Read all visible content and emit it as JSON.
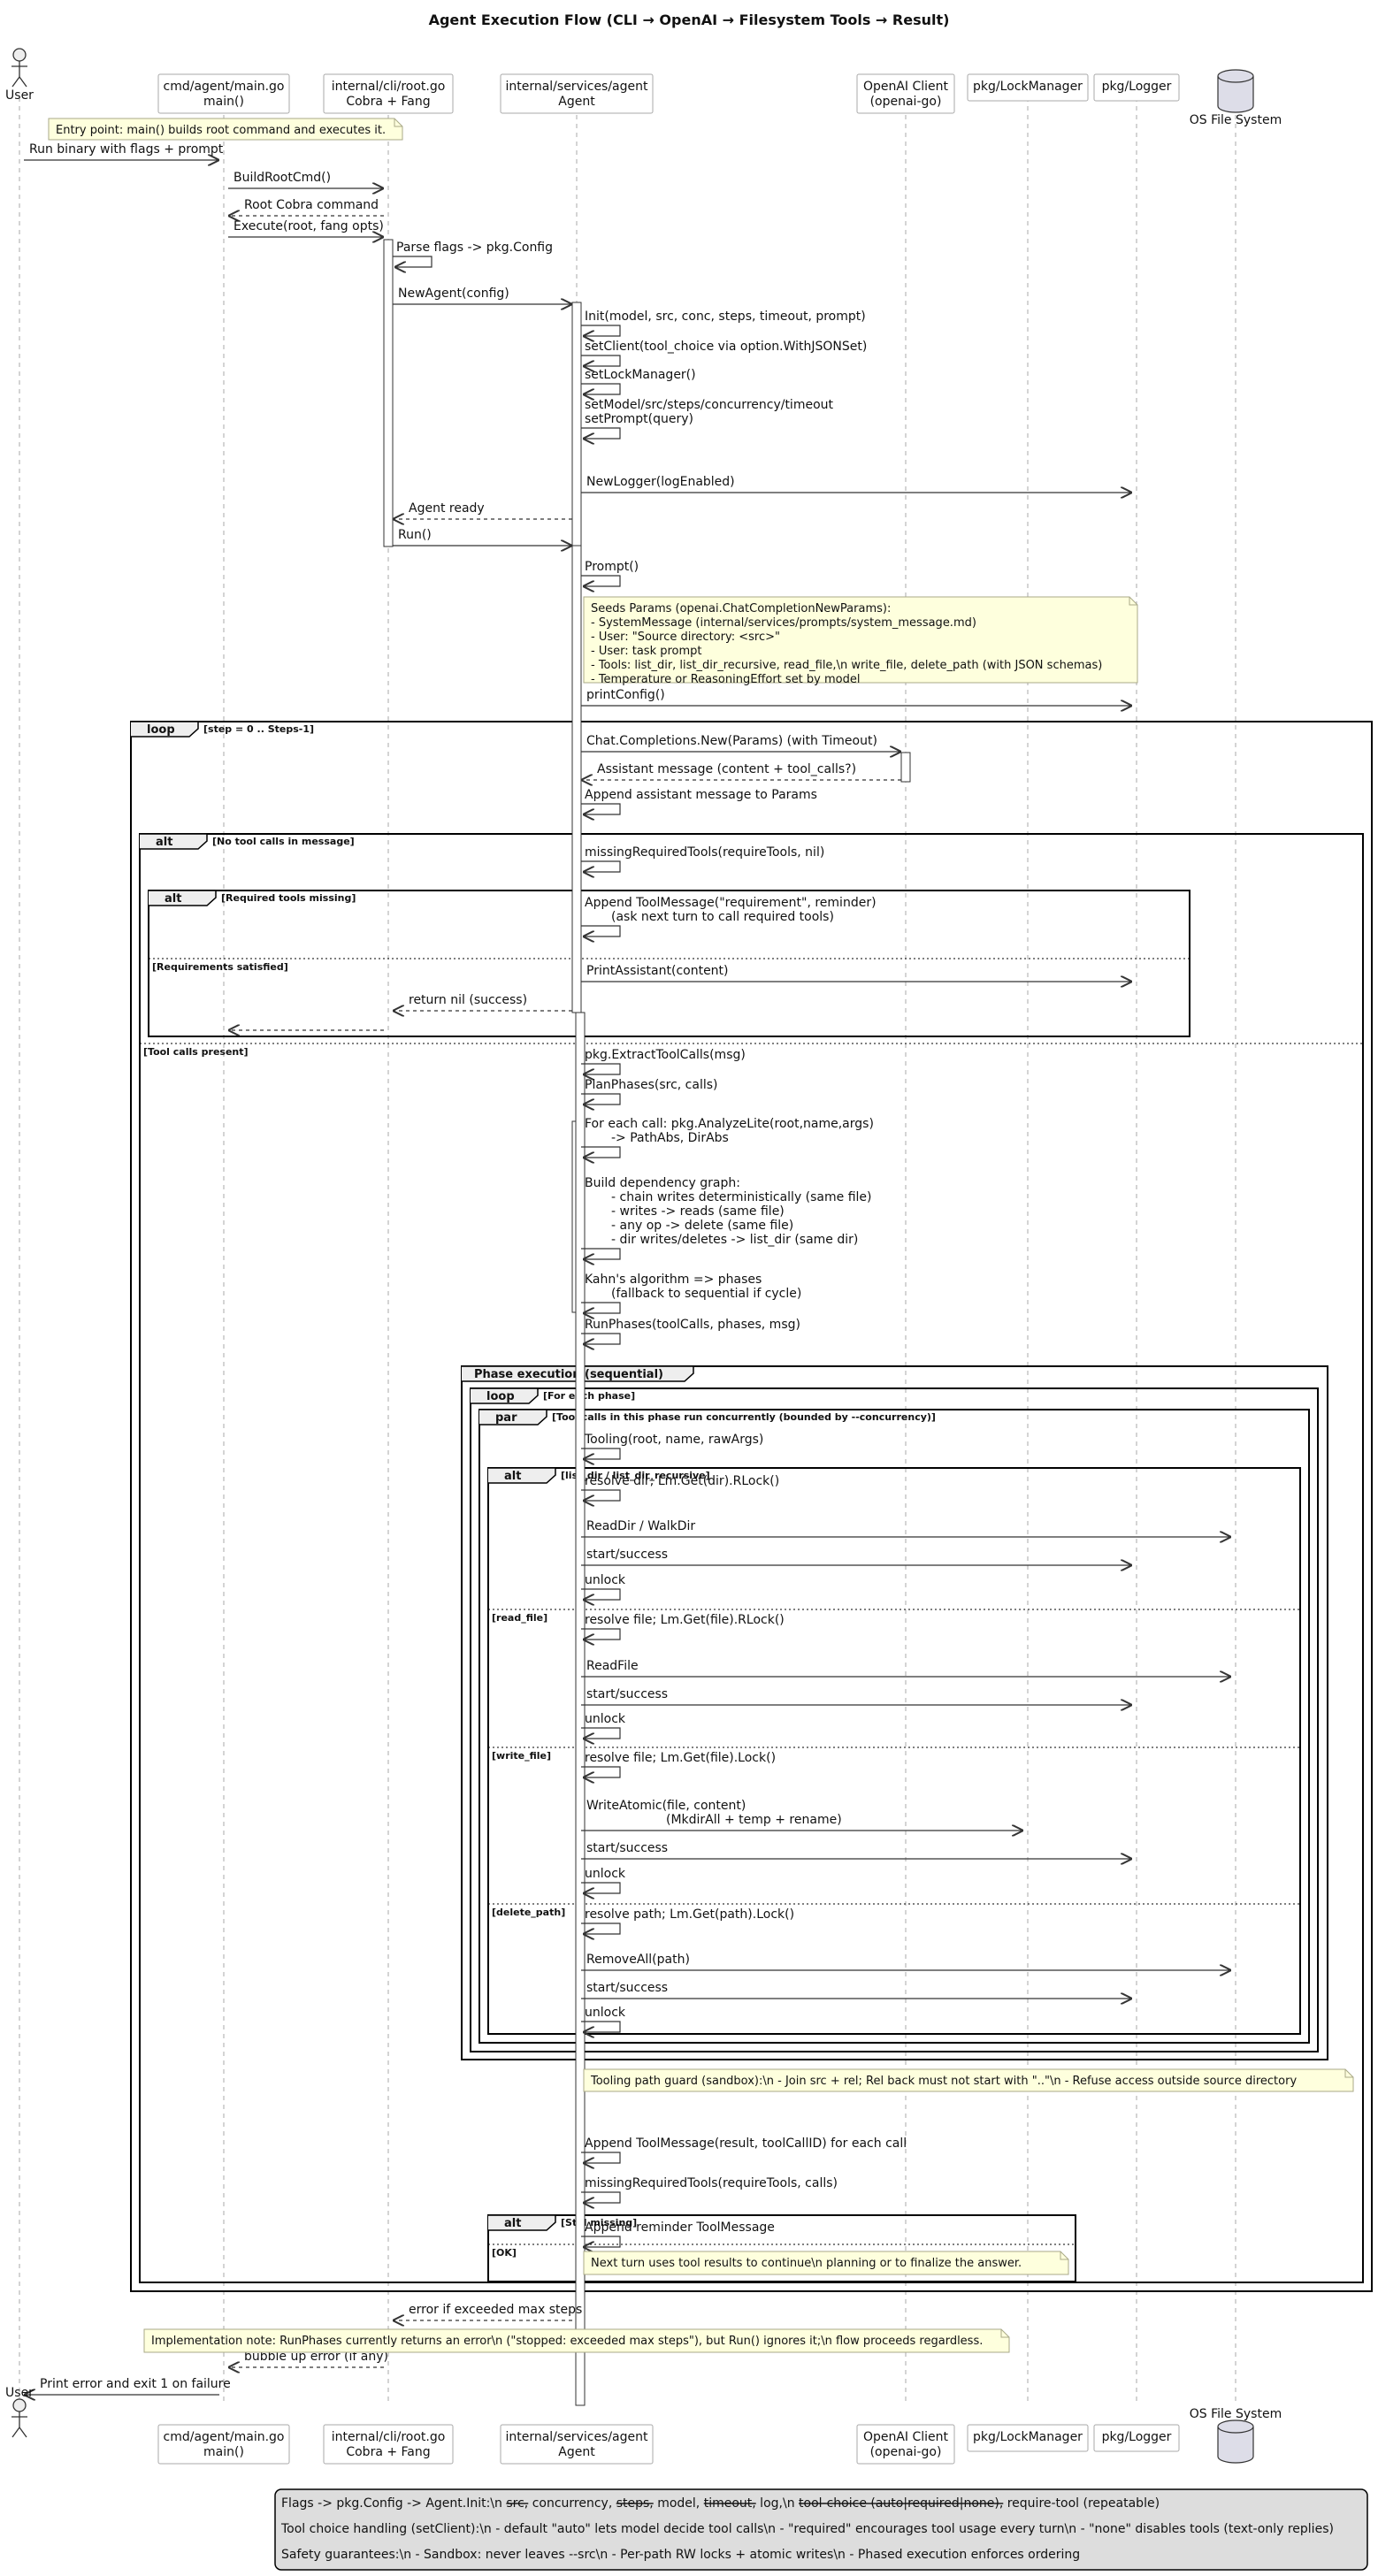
{
  "title": "Agent Execution Flow (CLI → OpenAI → Filesystem Tools → Result)",
  "participants": [
    {
      "id": "user",
      "kind": "actor",
      "lines": [
        "User"
      ]
    },
    {
      "id": "main",
      "kind": "box",
      "lines": [
        "cmd/agent/main.go",
        "main()"
      ]
    },
    {
      "id": "cli",
      "kind": "box",
      "lines": [
        "internal/cli/root.go",
        "Cobra + Fang"
      ]
    },
    {
      "id": "agent",
      "kind": "box",
      "lines": [
        "internal/services/agent",
        "Agent"
      ]
    },
    {
      "id": "openai",
      "kind": "box",
      "lines": [
        "OpenAI Client",
        "(openai-go)"
      ]
    },
    {
      "id": "lock",
      "kind": "box",
      "lines": [
        "pkg/LockManager"
      ]
    },
    {
      "id": "logger",
      "kind": "box",
      "lines": [
        "pkg/Logger"
      ]
    },
    {
      "id": "fs",
      "kind": "database",
      "lines": [
        "OS File System"
      ]
    }
  ],
  "messages": [
    {
      "id": "m1",
      "from": "user",
      "to": "main",
      "lines": [
        "Run binary with flags + prompt"
      ],
      "style": "solid"
    },
    {
      "id": "m2",
      "from": "main",
      "to": "cli",
      "lines": [
        "BuildRootCmd()"
      ],
      "style": "solid"
    },
    {
      "id": "m3",
      "from": "cli",
      "to": "main",
      "lines": [
        "Root Cobra command"
      ],
      "style": "dashed"
    },
    {
      "id": "m4",
      "from": "main",
      "to": "cli",
      "lines": [
        "Execute(root, fang opts)"
      ],
      "style": "solid"
    },
    {
      "id": "m5",
      "from": "cli",
      "to": "cli",
      "lines": [
        "Parse flags -> pkg.Config"
      ],
      "style": "self"
    },
    {
      "id": "m6",
      "from": "cli",
      "to": "agent",
      "lines": [
        "NewAgent(config)"
      ],
      "style": "solid"
    },
    {
      "id": "m7",
      "from": "agent",
      "to": "agent",
      "lines": [
        "Init(model, src, conc, steps, timeout, prompt)"
      ],
      "style": "self"
    },
    {
      "id": "m8",
      "from": "agent",
      "to": "agent",
      "lines": [
        "setClient(tool_choice via option.WithJSONSet)"
      ],
      "style": "self"
    },
    {
      "id": "m9",
      "from": "agent",
      "to": "agent",
      "lines": [
        "setLockManager()"
      ],
      "style": "self"
    },
    {
      "id": "m10",
      "from": "agent",
      "to": "agent",
      "lines": [
        "setModel/src/steps/concurrency/timeout",
        "setPrompt(query)"
      ],
      "style": "self"
    },
    {
      "id": "m11",
      "from": "agent",
      "to": "logger",
      "lines": [
        "NewLogger(logEnabled)"
      ],
      "style": "solid"
    },
    {
      "id": "m12",
      "from": "agent",
      "to": "cli",
      "lines": [
        "Agent ready"
      ],
      "style": "dashed"
    },
    {
      "id": "m13",
      "from": "cli",
      "to": "agent",
      "lines": [
        "Run()"
      ],
      "style": "solid"
    },
    {
      "id": "m14",
      "from": "agent",
      "to": "agent",
      "lines": [
        "Prompt()"
      ],
      "style": "self"
    },
    {
      "id": "m15",
      "from": "agent",
      "to": "logger",
      "lines": [
        "printConfig()"
      ],
      "style": "solid"
    },
    {
      "id": "m16",
      "from": "agent",
      "to": "openai",
      "lines": [
        "Chat.Completions.New(Params) (with Timeout)"
      ],
      "style": "solid"
    },
    {
      "id": "m17",
      "from": "openai",
      "to": "agent",
      "lines": [
        "Assistant message (content + tool_calls?)"
      ],
      "style": "dashed"
    },
    {
      "id": "m18",
      "from": "agent",
      "to": "agent",
      "lines": [
        "Append assistant message to Params"
      ],
      "style": "self"
    },
    {
      "id": "m19",
      "from": "agent",
      "to": "agent",
      "lines": [
        "missingRequiredTools(requireTools, nil)"
      ],
      "style": "self"
    },
    {
      "id": "m20",
      "from": "agent",
      "to": "agent",
      "lines": [
        "Append ToolMessage(\"requirement\", reminder)",
        "(ask next turn to call required tools)"
      ],
      "style": "self"
    },
    {
      "id": "m21",
      "from": "agent",
      "to": "logger",
      "lines": [
        "PrintAssistant(content)"
      ],
      "style": "solid"
    },
    {
      "id": "m22",
      "from": "agent",
      "to": "cli",
      "lines": [
        "return nil (success)"
      ],
      "style": "dashed"
    },
    {
      "id": "m23",
      "from": "cli",
      "to": "main",
      "lines": [
        ""
      ],
      "style": "dashed"
    },
    {
      "id": "m24",
      "from": "agent",
      "to": "agent",
      "lines": [
        "pkg.ExtractToolCalls(msg)"
      ],
      "style": "self"
    },
    {
      "id": "m25",
      "from": "agent",
      "to": "agent",
      "lines": [
        "PlanPhases(src, calls)"
      ],
      "style": "self"
    },
    {
      "id": "m26",
      "from": "agent",
      "to": "agent",
      "lines": [
        "For each call: pkg.AnalyzeLite(root,name,args)",
        "-> PathAbs, DirAbs"
      ],
      "style": "self"
    },
    {
      "id": "m27",
      "from": "agent",
      "to": "agent",
      "lines": [
        "Build dependency graph:",
        "- chain writes deterministically (same file)",
        "- writes -> reads (same file)",
        "- any op -> delete (same file)",
        "- dir writes/deletes -> list_dir (same dir)"
      ],
      "style": "self"
    },
    {
      "id": "m28",
      "from": "agent",
      "to": "agent",
      "lines": [
        "Kahn's algorithm => phases",
        "(fallback to sequential if cycle)"
      ],
      "style": "self"
    },
    {
      "id": "m29",
      "from": "agent",
      "to": "agent",
      "lines": [
        "RunPhases(toolCalls, phases, msg)"
      ],
      "style": "self"
    },
    {
      "id": "m30",
      "from": "agent",
      "to": "agent",
      "lines": [
        "Tooling(root, name, rawArgs)"
      ],
      "style": "self"
    },
    {
      "id": "m31",
      "from": "agent",
      "to": "agent",
      "lines": [
        "resolve dir; Lm.Get(dir).RLock()"
      ],
      "style": "self"
    },
    {
      "id": "m32",
      "from": "agent",
      "to": "fs",
      "lines": [
        "ReadDir / WalkDir"
      ],
      "style": "solid"
    },
    {
      "id": "m33",
      "from": "agent",
      "to": "logger",
      "lines": [
        "start/success"
      ],
      "style": "solid"
    },
    {
      "id": "m34",
      "from": "agent",
      "to": "agent",
      "lines": [
        "unlock"
      ],
      "style": "self"
    },
    {
      "id": "m35",
      "from": "agent",
      "to": "agent",
      "lines": [
        "resolve file; Lm.Get(file).RLock()"
      ],
      "style": "self"
    },
    {
      "id": "m36",
      "from": "agent",
      "to": "fs",
      "lines": [
        "ReadFile"
      ],
      "style": "solid"
    },
    {
      "id": "m37",
      "from": "agent",
      "to": "logger",
      "lines": [
        "start/success"
      ],
      "style": "solid"
    },
    {
      "id": "m38",
      "from": "agent",
      "to": "agent",
      "lines": [
        "unlock"
      ],
      "style": "self"
    },
    {
      "id": "m39",
      "from": "agent",
      "to": "agent",
      "lines": [
        "resolve file; Lm.Get(file).Lock()"
      ],
      "style": "self"
    },
    {
      "id": "m40",
      "from": "agent",
      "to": "lock",
      "lines": [
        "WriteAtomic(file, content)",
        "(MkdirAll + temp + rename)"
      ],
      "style": "solid"
    },
    {
      "id": "m41",
      "from": "agent",
      "to": "logger",
      "lines": [
        "start/success"
      ],
      "style": "solid"
    },
    {
      "id": "m42",
      "from": "agent",
      "to": "agent",
      "lines": [
        "unlock"
      ],
      "style": "self"
    },
    {
      "id": "m43",
      "from": "agent",
      "to": "agent",
      "lines": [
        "resolve path; Lm.Get(path).Lock()"
      ],
      "style": "self"
    },
    {
      "id": "m44",
      "from": "agent",
      "to": "fs",
      "lines": [
        "RemoveAll(path)"
      ],
      "style": "solid"
    },
    {
      "id": "m45",
      "from": "agent",
      "to": "logger",
      "lines": [
        "start/success"
      ],
      "style": "solid"
    },
    {
      "id": "m46",
      "from": "agent",
      "to": "agent",
      "lines": [
        "unlock"
      ],
      "style": "self"
    },
    {
      "id": "m47",
      "from": "agent",
      "to": "agent",
      "lines": [
        "Append ToolMessage(result, toolCallID) for each call"
      ],
      "style": "self"
    },
    {
      "id": "m48",
      "from": "agent",
      "to": "agent",
      "lines": [
        "missingRequiredTools(requireTools, calls)"
      ],
      "style": "self"
    },
    {
      "id": "m49",
      "from": "agent",
      "to": "agent",
      "lines": [
        "Append reminder ToolMessage"
      ],
      "style": "self"
    },
    {
      "id": "m50",
      "from": "agent",
      "to": "cli",
      "lines": [
        "error if exceeded max steps"
      ],
      "style": "dashed"
    },
    {
      "id": "m51",
      "from": "cli",
      "to": "main",
      "lines": [
        "bubble up error (if any)"
      ],
      "style": "dashed"
    },
    {
      "id": "m52",
      "from": "main",
      "to": "user",
      "lines": [
        "Print error and exit 1 on failure"
      ],
      "style": "solid"
    }
  ],
  "notes": [
    {
      "id": "n1",
      "lines": [
        "Entry point: main() builds root command and executes it."
      ]
    },
    {
      "id": "n2",
      "lines": [
        "Seeds Params (openai.ChatCompletionNewParams):",
        "- SystemMessage (internal/services/prompts/system_message.md)",
        "- User: \"Source directory: <src>\"",
        "- User: task prompt",
        "- Tools: list_dir, list_dir_recursive, read_file,\\n    write_file, delete_path (with JSON schemas)",
        "- Temperature or ReasoningEffort set by model"
      ]
    },
    {
      "id": "n3",
      "lines": [
        "Tooling path guard (sandbox):\\n      - Join src + rel; Rel back must not start with \"..\"\\n      - Refuse access outside source directory"
      ]
    },
    {
      "id": "n4",
      "lines": [
        "Next turn uses tool results to continue\\n        planning or to finalize the answer."
      ]
    },
    {
      "id": "n5",
      "lines": [
        "Implementation note: RunPhases currently returns an error\\n  (\"stopped: exceeded max steps\"), but Run() ignores it;\\n  flow proceeds regardless."
      ]
    }
  ],
  "frames": [
    {
      "id": "f-loop-steps",
      "kind": "loop",
      "guard": "[step = 0 .. Steps-1]"
    },
    {
      "id": "f-alt-toolcalls",
      "kind": "alt",
      "guard": "[No tool calls in message]",
      "else": [
        "[Tool calls present]"
      ]
    },
    {
      "id": "f-alt-required",
      "kind": "alt",
      "guard": "[Required tools missing]",
      "else": [
        "[Requirements satisfied]"
      ]
    },
    {
      "id": "f-group-phase",
      "kind": "Phase execution (sequential)",
      "guard": ""
    },
    {
      "id": "f-loop-phase",
      "kind": "loop",
      "guard": "[For each phase]"
    },
    {
      "id": "f-par",
      "kind": "par",
      "guard": "[Tool calls in this phase run concurrently (bounded by --concurrency)]"
    },
    {
      "id": "f-alt-tools",
      "kind": "alt",
      "guard": "[list_dir / list_dir_recursive]",
      "else": [
        "[read_file]",
        "[write_file]",
        "[delete_path]"
      ]
    },
    {
      "id": "f-alt-still",
      "kind": "alt",
      "guard": "[Still missing]",
      "else": [
        "[OK]"
      ]
    }
  ],
  "legend": {
    "line1_pre": "Flags -> pkg.Config -> Agent.Init:\\n  ",
    "line1_parts": [
      {
        "text": "src,",
        "strike": true
      },
      {
        "text": " concurrency, ",
        "strike": false
      },
      {
        "text": "steps,",
        "strike": true
      },
      {
        "text": " model, ",
        "strike": false
      },
      {
        "text": "timeout,",
        "strike": true
      },
      {
        "text": " log,\\n  ",
        "strike": false
      },
      {
        "text": "tool-choice (auto|required|none),",
        "strike": true
      },
      {
        "text": " require-tool (repeatable)",
        "strike": false
      }
    ],
    "line2": "Tool choice handling (setClient):\\n   - default \"auto\" lets model decide tool calls\\n   - \"required\" encourages tool usage every turn\\n   - \"none\" disables tools (text-only replies)",
    "line3": "Safety guarantees:\\n   - Sandbox: never leaves --src\\n   - Per-path RW locks + atomic writes\\n   - Phased execution enforces ordering"
  }
}
